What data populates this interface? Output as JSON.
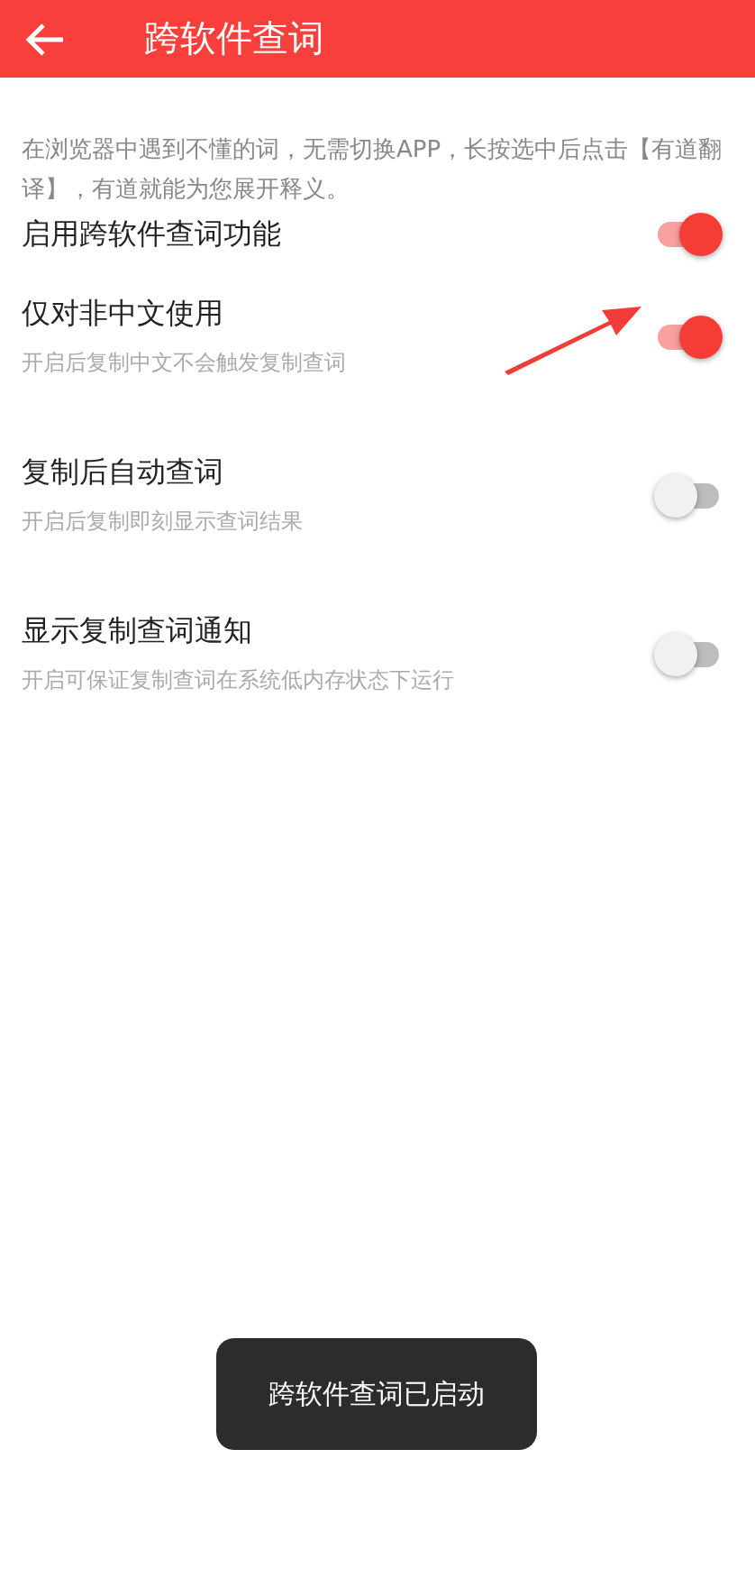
{
  "header": {
    "title": "跨软件查词"
  },
  "description": "在浏览器中遇到不懂的词，无需切换APP，长按选中后点击【有道翻译】，有道就能为您展开释义。",
  "settings": [
    {
      "title": "启用跨软件查词功能",
      "on": true
    },
    {
      "title": "仅对非中文使用",
      "subtitle": "开启后复制中文不会触发复制查词",
      "on": true
    },
    {
      "title": "复制后自动查词",
      "subtitle": "开启后复制即刻显示查词结果",
      "on": false
    },
    {
      "title": "显示复制查词通知",
      "subtitle": "开启可保证复制查词在系统低内存状态下运行",
      "on": false
    }
  ],
  "toast": "跨软件查词已启动"
}
